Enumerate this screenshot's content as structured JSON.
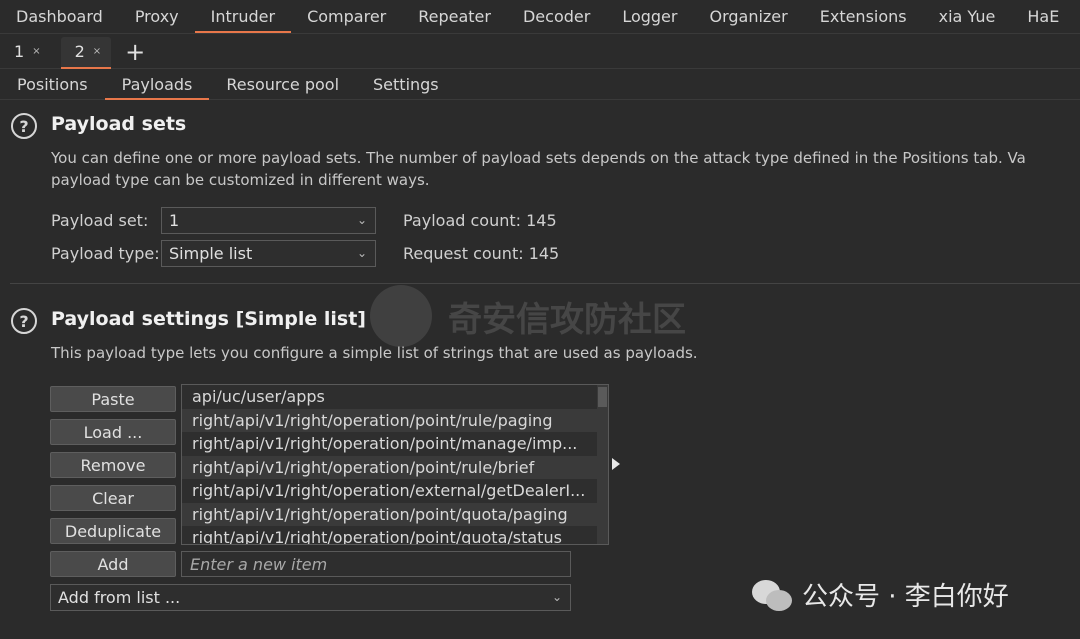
{
  "top_tabs": [
    "Dashboard",
    "Proxy",
    "Intruder",
    "Comparer",
    "Repeater",
    "Decoder",
    "Logger",
    "Organizer",
    "Extensions",
    "xia Yue",
    "HaE"
  ],
  "top_active": "Intruder",
  "instance_tabs": [
    {
      "label": "1",
      "close": "×"
    },
    {
      "label": "2",
      "close": "×"
    }
  ],
  "plus": "+",
  "sub_tabs": [
    "Positions",
    "Payloads",
    "Resource pool",
    "Settings"
  ],
  "help_glyph": "?",
  "payload_sets": {
    "title": "Payload sets",
    "desc1": "You can define one or more payload sets. The number of payload sets depends on the attack type defined in the Positions tab. Va",
    "desc2": "payload type can be customized in different ways.",
    "set_label": "Payload set:",
    "set_value": "1",
    "type_label": "Payload type:",
    "type_value": "Simple list",
    "payload_count": "Payload count: 145",
    "request_count": "Request count: 145"
  },
  "payload_settings": {
    "title": "Payload settings [Simple list]",
    "desc": "This payload type lets you configure a simple list of strings that are used as payloads.",
    "buttons": [
      "Paste",
      "Load ...",
      "Remove",
      "Clear",
      "Deduplicate",
      "Add"
    ],
    "items": [
      "api/uc/user/apps",
      "right/api/v1/right/operation/point/rule/paging",
      "right/api/v1/right/operation/point/manage/imp...",
      "right/api/v1/right/operation/point/rule/brief",
      "right/api/v1/right/operation/external/getDealerI...",
      "right/api/v1/right/operation/point/quota/paging",
      "right/api/v1/right/operation/point/quota/status"
    ],
    "add_placeholder": "Enter a new item",
    "add_from_list": "Add from list ..."
  },
  "watermark_text": "奇安信攻防社区",
  "wechat_text": "公众号 · 李白你好"
}
